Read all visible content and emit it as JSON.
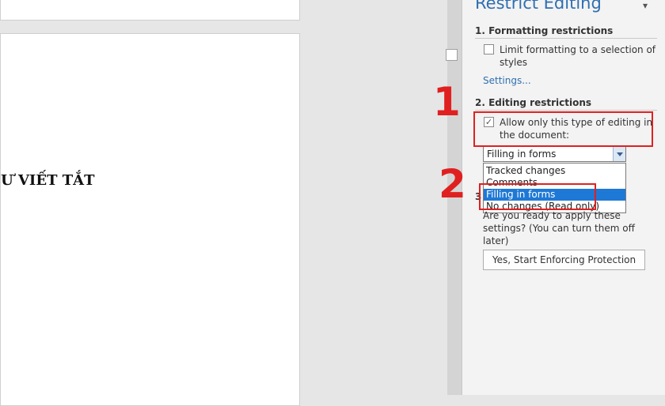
{
  "document": {
    "visible_text": "Ư VIẾT TẮT"
  },
  "pane": {
    "title": "Restrict Editing",
    "close_label": "▾",
    "formatting": {
      "header": "1. Formatting restrictions",
      "checkbox_label": "Limit formatting to a selection of styles",
      "checked": false,
      "settings_link": "Settings..."
    },
    "editing": {
      "header": "2. Editing restrictions",
      "checkbox_label": "Allow only this type of editing in the document:",
      "checked": true,
      "checkmark": "✓",
      "selected_value": "Filling in forms",
      "options": [
        "Tracked changes",
        "Comments",
        "Filling in forms",
        "No changes (Read only)"
      ],
      "highlighted_index": 2
    },
    "enforcement": {
      "number": "3",
      "text": "Are you ready to apply these settings? (You can turn them off later)",
      "button_label": "Yes, Start Enforcing Protection"
    }
  },
  "callouts": {
    "first": "1",
    "second": "2",
    "color": "#e02020"
  }
}
